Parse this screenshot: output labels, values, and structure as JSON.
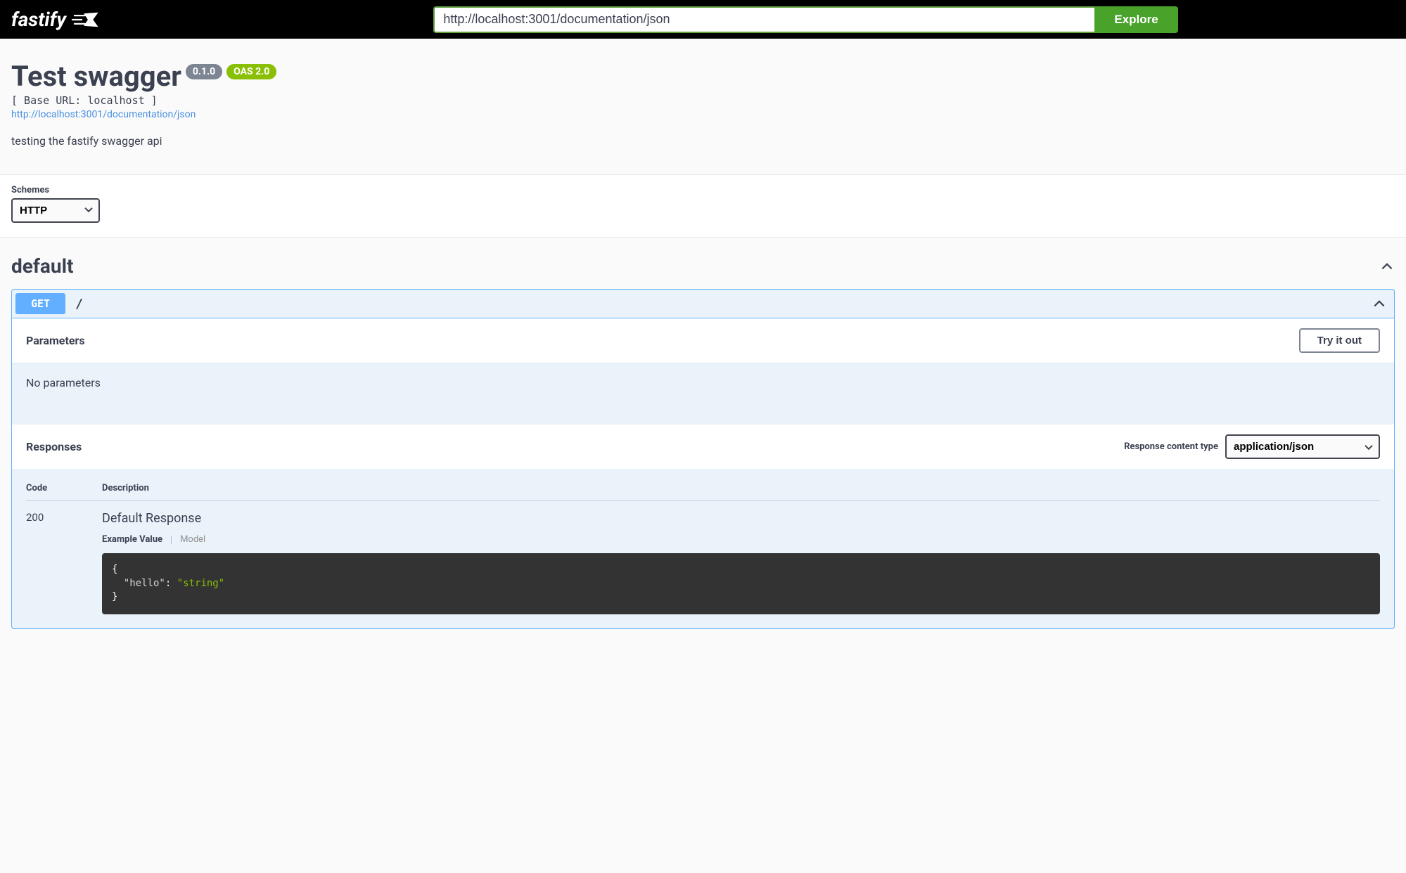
{
  "topbar": {
    "brand": "fastify",
    "url_value": "http://localhost:3001/documentation/json",
    "explore_label": "Explore"
  },
  "info": {
    "title": "Test swagger",
    "version": "0.1.0",
    "oas_badge": "OAS 2.0",
    "base_url_label": "[ Base URL: localhost ]",
    "spec_url": "http://localhost:3001/documentation/json",
    "description": "testing the fastify swagger api"
  },
  "schemes": {
    "label": "Schemes",
    "selected": "HTTP"
  },
  "tag": {
    "name": "default"
  },
  "operation": {
    "method": "GET",
    "path": "/",
    "parameters_title": "Parameters",
    "try_label": "Try it out",
    "no_params": "No parameters",
    "responses_title": "Responses",
    "content_type_label": "Response content type",
    "content_type_selected": "application/json",
    "table": {
      "code_header": "Code",
      "desc_header": "Description"
    },
    "response": {
      "code": "200",
      "description": "Default Response",
      "example_tab": "Example Value",
      "model_tab": "Model",
      "example_key": "\"hello\"",
      "example_val": "\"string\""
    }
  }
}
